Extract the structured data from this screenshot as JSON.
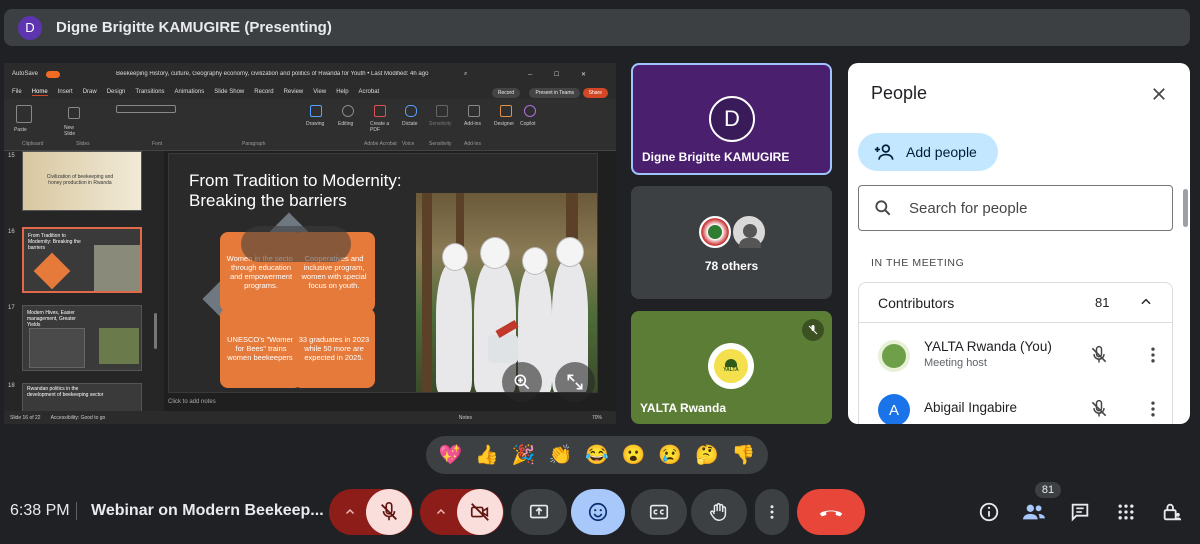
{
  "presenting_bar": {
    "initial": "D",
    "title": "Digne Brigitte KAMUGIRE (Presenting)"
  },
  "ppt": {
    "window_title": "Beekeeping History, culture, Geography economy, civilization and politics of Rwanda for Youth • Last Modified: 4h ago",
    "autosave": "AutoSave",
    "menu": [
      "File",
      "Home",
      "Insert",
      "Draw",
      "Design",
      "Transitions",
      "Animations",
      "Slide Show",
      "Record",
      "Review",
      "View",
      "Help",
      "Acrobat"
    ],
    "record_label": "Record",
    "present_teams": "Present in Teams",
    "share_label": "Share",
    "ribbon": {
      "paste": "Paste",
      "new_slide": "New Slide",
      "drawing": "Drawing",
      "editing": "Editing",
      "create_pdf": "Create a PDF",
      "dictate": "Dictate",
      "sensitivity": "Sensitivity",
      "addins": "Add-ins",
      "designer": "Designer",
      "copilot": "Copilot",
      "groups": [
        "Clipboard",
        "Slides",
        "Font",
        "Paragraph",
        "Adobe Acrobat",
        "Voice",
        "Sensitivity",
        "Add-ins"
      ]
    },
    "thumbs": [
      {
        "num": "15",
        "text": "Civilization of beekeeping and honey production in Rwanda"
      },
      {
        "num": "16",
        "text": "From Tradition to Modernity: Breaking the barriers"
      },
      {
        "num": "17",
        "text": "Modern Hives, Easier management, Greater Yields"
      },
      {
        "num": "18",
        "text": "Rwandan politics in the development of beekeeping sector"
      }
    ],
    "slide": {
      "title": "From Tradition to Modernity: Breaking the barriers",
      "box1": "Women in the sector through education and empowerment programs.",
      "box2": "Cooperatives and inclusive program, women with special focus on youth.",
      "box3": "UNESCO's \"Women for Bees\" trains women beekeepers.",
      "box4": "33 graduates in 2023 while 50 more are expected in 2025."
    },
    "notes_placeholder": "Click to add notes",
    "status": {
      "slide": "Slide 16 of 22",
      "accessibility": "Accessibility: Good to go",
      "notes": "Notes",
      "zoom": "70%"
    }
  },
  "tiles": {
    "presenter": {
      "initial": "D",
      "name": "Digne Brigitte KAMUGIRE"
    },
    "others": {
      "label": "78 others"
    },
    "yalta": {
      "name": "YALTA Rwanda",
      "logo_text": "YALTA"
    }
  },
  "people_panel": {
    "title": "People",
    "add_people": "Add people",
    "search_placeholder": "Search for people",
    "section": "IN THE MEETING",
    "contributors_label": "Contributors",
    "contributors_count": "81",
    "people": [
      {
        "name": "YALTA Rwanda (You)",
        "sub": "Meeting host",
        "avatar": "",
        "color": "#6ea04a"
      },
      {
        "name": "Abigail Ingabire",
        "sub": "",
        "avatar": "A",
        "color": "#1a73e8"
      }
    ]
  },
  "reactions": [
    "💖",
    "👍",
    "🎉",
    "👏",
    "😂",
    "😮",
    "😢",
    "🤔",
    "👎"
  ],
  "bottom": {
    "time": "6:38 PM",
    "meeting_name": "Webinar on Modern Beekeep...",
    "people_badge": "81"
  },
  "colors": {
    "end_call": "#e9463a",
    "mic_off_bg": "#f9dedc",
    "accent_blue": "#a8c7fa",
    "brand_purple": "#4a1f6e"
  }
}
